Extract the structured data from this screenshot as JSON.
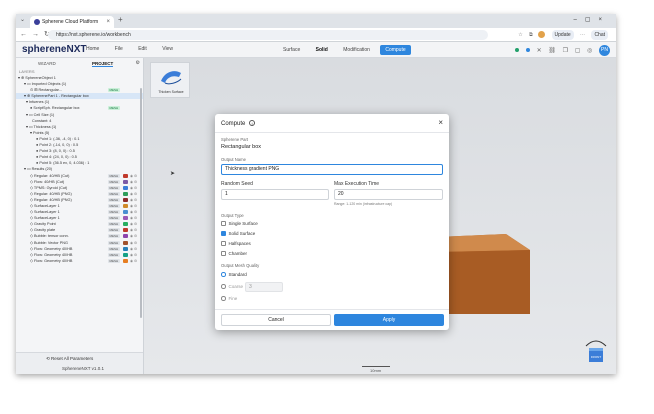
{
  "browser": {
    "tab_title": "Spherene Cloud Platform",
    "url": "https://nxt.spherene.io/workbench",
    "update_label": "Update",
    "chat_label": "Chat"
  },
  "app": {
    "logo_main": "sphereneN",
    "logo_accent": "XT",
    "menu": [
      "Home",
      "File",
      "Edit",
      "View"
    ],
    "modes": [
      "Surface",
      "Solid",
      "Modification",
      "Compute"
    ],
    "user_initials": "PN"
  },
  "sidebar": {
    "tabs": [
      "WIZARD",
      "PROJECT"
    ],
    "layers_label": "LAYERS",
    "rows": [
      {
        "indent": 2,
        "label": "▾ ⊕ SphereneObject 1",
        "badge": "",
        "color": "",
        "selected": false
      },
      {
        "indent": 8,
        "label": "▾ ▭ Imported Objects (1)",
        "badge": "",
        "color": "",
        "selected": false
      },
      {
        "indent": 14,
        "label": "⊙ ⊞ Rectangular...",
        "badge": "MESH",
        "badgeGreen": true,
        "color": "",
        "selected": false
      },
      {
        "indent": 8,
        "label": "▾ ⊕ SpherenePart 1 - Rectangular box",
        "badge": "",
        "color": "",
        "selected": true
      },
      {
        "indent": 10,
        "label": "▾ Infuenes (1)",
        "badge": "",
        "color": "",
        "selected": false
      },
      {
        "indent": 14,
        "label": "● ScriptSph. Rectangular box",
        "badge": "MESH",
        "badgeGreen": true,
        "color": "",
        "selected": false
      },
      {
        "indent": 10,
        "label": "▾ ▭ Cell Size (1)",
        "badge": "",
        "color": "",
        "selected": false
      },
      {
        "indent": 16,
        "label": "Constant: 4",
        "badge": "",
        "color": "",
        "selected": false
      },
      {
        "indent": 10,
        "label": "▾ ▭ Thickness (1)",
        "badge": "",
        "color": "",
        "selected": false
      },
      {
        "indent": 14,
        "label": "▾ Points (5)",
        "badge": "",
        "color": "",
        "selected": false
      },
      {
        "indent": 20,
        "label": "● Point 1: (-36, -4, 0) : 0.1",
        "badge": "",
        "color": "",
        "selected": false
      },
      {
        "indent": 20,
        "label": "● Point 2: (-14, 0, 0) : 0.5",
        "badge": "",
        "color": "",
        "selected": false
      },
      {
        "indent": 20,
        "label": "● Point 3: (8, 0, 0) : 0.5",
        "badge": "",
        "color": "",
        "selected": false
      },
      {
        "indent": 20,
        "label": "● Point 4: (24, 0, 0) : 0.5",
        "badge": "",
        "color": "",
        "selected": false
      },
      {
        "indent": 20,
        "label": "● Point 5: (36.5 ex, 0, 4.036) : 1",
        "badge": "",
        "color": "",
        "selected": false
      },
      {
        "indent": 8,
        "label": "▾ ▭ Results (20)",
        "badge": "",
        "color": "",
        "selected": false
      },
      {
        "indent": 14,
        "label": "◇ Regular: 40/HB (Cut)",
        "badge": "MESH",
        "color": "#c0392b",
        "selected": false
      },
      {
        "indent": 14,
        "label": "◇ Flow: 40/HB (Cut)",
        "badge": "MESH",
        "color": "#7b5aa6",
        "selected": false
      },
      {
        "indent": 14,
        "label": "◇ TPMS: Gyroid (Cut)",
        "badge": "MESH",
        "color": "#3b7dd8",
        "selected": false
      },
      {
        "indent": 14,
        "label": "◇ Regular: 40/HB (PNG)",
        "badge": "MESH",
        "color": "#2e9e5b",
        "selected": false
      },
      {
        "indent": 14,
        "label": "◇ Regular: 40/HB (PNG)",
        "badge": "MESH",
        "color": "#8e2b2b",
        "selected": false
      },
      {
        "indent": 14,
        "label": "◇ SurfaceLayer 1",
        "badge": "MESH",
        "color": "#d08a2a",
        "selected": false
      },
      {
        "indent": 14,
        "label": "◇ SurfaceLayer 1",
        "badge": "MESH",
        "color": "#4a8fd1",
        "selected": false
      },
      {
        "indent": 14,
        "label": "◇ SurfaceLayer 1",
        "badge": "MESH",
        "color": "#9b59b6",
        "selected": false
      },
      {
        "indent": 14,
        "label": "◇ Gravity Point",
        "badge": "MESH",
        "color": "#27ae60",
        "selected": false
      },
      {
        "indent": 14,
        "label": "◇ Gravity plate",
        "badge": "MESH",
        "color": "#c0392b",
        "selected": false
      },
      {
        "indent": 14,
        "label": "◇ Bubble: tensor conn.",
        "badge": "MESH",
        "color": "#8e44ad",
        "selected": false
      },
      {
        "indent": 14,
        "label": "◇ Bubble: Vector PNG",
        "badge": "MESH",
        "color": "#a0522d",
        "selected": false
      },
      {
        "indent": 14,
        "label": "◇ Flow: Geometry 40/HB",
        "badge": "MESH",
        "color": "#2980b9",
        "selected": false
      },
      {
        "indent": 14,
        "label": "◇ Flow: Geometry 40/HB",
        "badge": "MESH",
        "color": "#16a085",
        "selected": false
      },
      {
        "indent": 14,
        "label": "◇ Flow: Geometry 40/HB",
        "badge": "MESH",
        "color": "#e67e22",
        "selected": false
      }
    ],
    "reset_label": "Reset All Parameters",
    "version": "SphereneNXT v1.0.1"
  },
  "viewport": {
    "thumb_caption": "Thicken Surface",
    "scale_label": "10mm"
  },
  "dialog": {
    "title": "Compute",
    "part_label": "Spherene Part",
    "part_value": "Rectangular box",
    "output_name_label": "Output Name",
    "output_name_value": "Thickness gradient PNG",
    "seed_label": "Random Seed",
    "seed_value": "1",
    "max_time_label": "Max Execution Time",
    "max_time_value": "20",
    "max_time_hint": "Range: 1-120 min (infrastructure cap)",
    "output_type_label": "Output Type",
    "output_types": [
      {
        "label": "Single Surface",
        "checked": false
      },
      {
        "label": "Solid Surface",
        "checked": true
      },
      {
        "label": "Halfspaces",
        "checked": false
      },
      {
        "label": "Chamber",
        "checked": false
      }
    ],
    "mesh_quality_label": "Output Mesh Quality",
    "mesh_options": [
      {
        "label": "Standard",
        "selected": true,
        "disabled": false
      },
      {
        "label": "Coarse",
        "selected": false,
        "disabled": true
      },
      {
        "label": "Fine",
        "selected": false,
        "disabled": true
      }
    ],
    "coarse_value": "3",
    "cancel_label": "Cancel",
    "apply_label": "Apply"
  },
  "colors": {
    "accent": "#2e86de",
    "box_front": "#b5672b",
    "box_top": "#d08a4c"
  }
}
